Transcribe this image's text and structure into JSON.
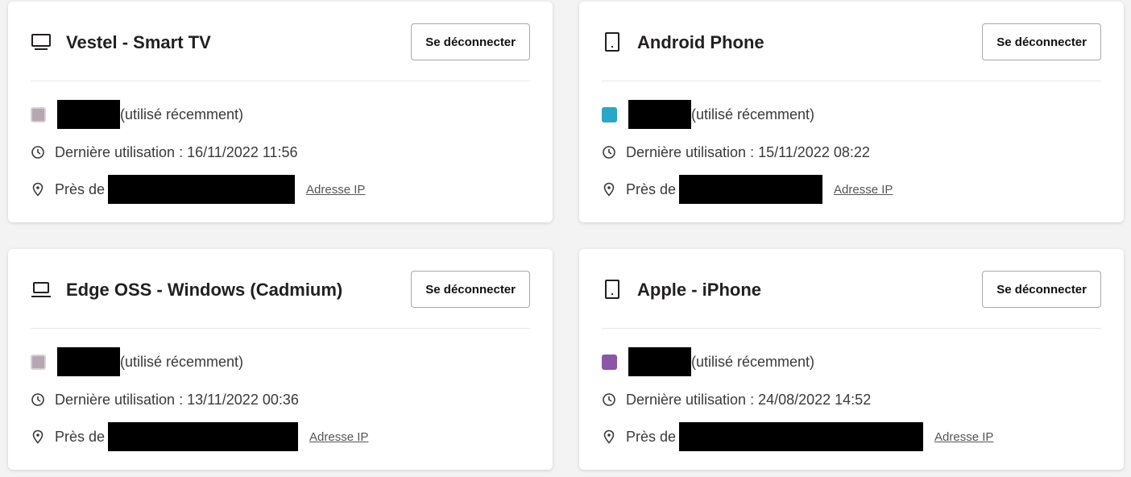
{
  "devices": [
    {
      "name": "Vestel - Smart TV",
      "signout_label": "Se déconnecter",
      "profile_status": "(utilisé récemment)",
      "last_used": "Dernière utilisation : 16/11/2022 11:56",
      "location_prefix": "Près de",
      "ip_link": "Adresse IP",
      "icon": "tv-icon",
      "avatar_color": "#b7a7b3"
    },
    {
      "name": "Android Phone",
      "signout_label": "Se déconnecter",
      "profile_status": "(utilisé récemment)",
      "last_used": "Dernière utilisation : 15/11/2022 08:22",
      "location_prefix": "Près de",
      "ip_link": "Adresse IP",
      "icon": "phone-icon",
      "avatar_color": "#2aa6c6"
    },
    {
      "name": "Edge OSS - Windows (Cadmium)",
      "signout_label": "Se déconnecter",
      "profile_status": "(utilisé récemment)",
      "last_used": "Dernière utilisation : 13/11/2022 00:36",
      "location_prefix": "Près de",
      "ip_link": "Adresse IP",
      "icon": "laptop-icon",
      "avatar_color": "#b7a7b3"
    },
    {
      "name": "Apple - iPhone",
      "signout_label": "Se déconnecter",
      "profile_status": "(utilisé récemment)",
      "last_used": "Dernière utilisation : 24/08/2022 14:52",
      "location_prefix": "Près de",
      "ip_link": "Adresse IP",
      "icon": "phone-icon",
      "avatar_color": "#8b55a8"
    }
  ],
  "colors": {
    "page_background": "#f3f3f3",
    "card_background": "#ffffff",
    "text": "#221f1f",
    "redaction": "#000000"
  }
}
